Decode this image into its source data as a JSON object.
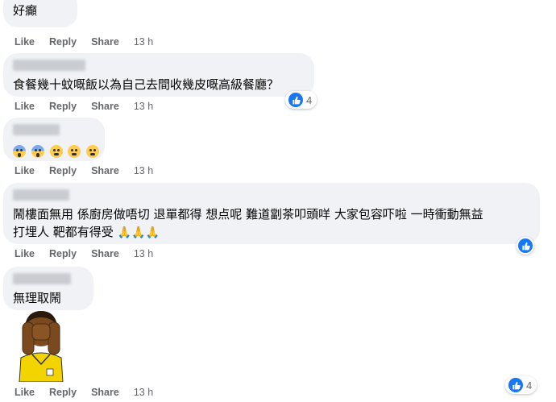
{
  "comments": [
    {
      "text": "好癲",
      "actions": {
        "like": "Like",
        "reply": "Reply",
        "share": "Share",
        "time": "13 h"
      }
    },
    {
      "text": "食餐幾十蚊嘅飯以為自己去間收幾皮嘅高級餐廳？",
      "actions": {
        "like": "Like",
        "reply": "Reply",
        "share": "Share",
        "time": "13 h"
      },
      "reaction_count": "4"
    },
    {
      "emojis": [
        "face-screaming-in-fear",
        "face-screaming-in-fear",
        "face-with-steam",
        "face-with-steam",
        "face-with-steam"
      ],
      "actions": {
        "like": "Like",
        "reply": "Reply",
        "share": "Share",
        "time": "13 h"
      }
    },
    {
      "text_line1": "鬧樓面無用 係廚房做唔切 退單都得 想点呢 難道劏茶叩頭咩 大家包容吓啦 一時衝動無益",
      "text_line2": "打埋人 靶都有得受",
      "emojis": [
        "folded-hands",
        "folded-hands",
        "folded-hands"
      ],
      "actions": {
        "like": "Like",
        "reply": "Reply",
        "share": "Share",
        "time": "13 h"
      }
    },
    {
      "text": "無理取鬧",
      "sticker": "face-palm-sticker",
      "actions": {
        "like": "Like",
        "reply": "Reply",
        "share": "Share",
        "time": "13 h"
      },
      "reaction_count": "4"
    }
  ],
  "colors": {
    "bubble": "#f0f2f5",
    "like_blue": "#1877f2",
    "meta": "#65676b"
  }
}
